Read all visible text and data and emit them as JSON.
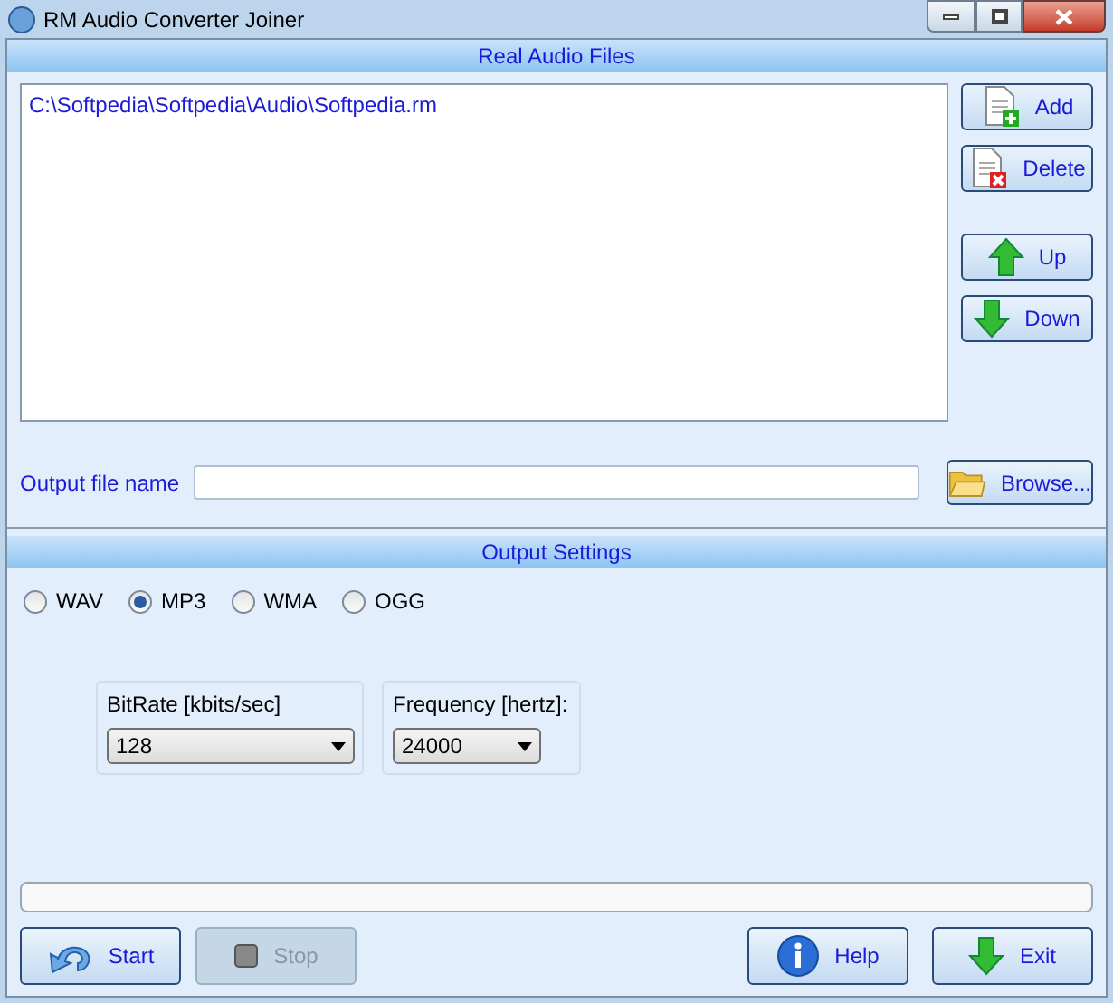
{
  "window": {
    "title": "RM Audio Converter Joiner"
  },
  "files_section": {
    "title": "Real Audio Files",
    "files": [
      "C:\\Softpedia\\Softpedia\\Audio\\Softpedia.rm"
    ],
    "buttons": [
      {
        "kind": "add",
        "label": "Add",
        "disabled": false
      },
      {
        "kind": "delete",
        "label": "Delete",
        "disabled": false
      },
      {
        "kind": "up",
        "label": "Up",
        "disabled": false
      },
      {
        "kind": "down",
        "label": "Down",
        "disabled": false
      }
    ]
  },
  "output_file": {
    "label": "Output file name",
    "browse": {
      "kind": "browse",
      "label": "Browse...",
      "disabled": false
    }
  },
  "settings": {
    "title": "Output Settings",
    "formats": [
      {
        "label": "WAV",
        "selected": false
      },
      {
        "label": "MP3",
        "selected": true
      },
      {
        "label": "WMA",
        "selected": false
      },
      {
        "label": "OGG",
        "selected": false
      }
    ],
    "bitrate": {
      "label": "BitRate [kbits/sec]",
      "value": "128"
    },
    "frequency": {
      "label": "Frequency [hertz]:",
      "value": "24000"
    }
  },
  "progress": {
    "level": 0
  },
  "bottom_buttons": [
    {
      "kind": "start",
      "label": "Start",
      "disabled": false
    },
    {
      "kind": "stop",
      "label": "Stop",
      "disabled": true
    },
    {
      "kind": "help",
      "label": "Help",
      "disabled": false
    },
    {
      "kind": "exit",
      "label": "Exit",
      "disabled": false
    }
  ]
}
